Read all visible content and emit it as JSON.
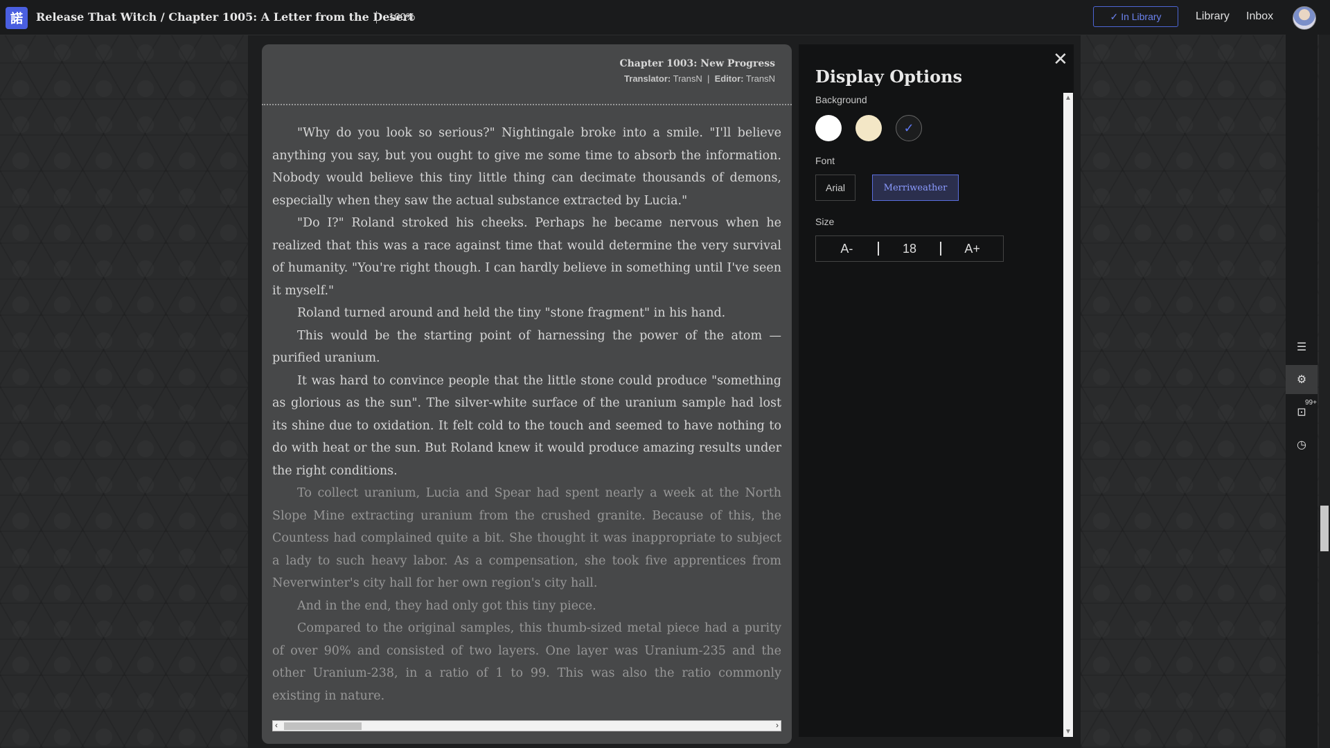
{
  "topbar": {
    "logo_glyph": "諾",
    "breadcrumb": "Release That Witch / Chapter 1005: A Letter from the Desert",
    "zoom": "100%",
    "in_library_label": "In Library",
    "library_label": "Library",
    "inbox_label": "Inbox"
  },
  "reader": {
    "chapter_title": "Chapter 1003: New Progress",
    "translator_label": "Translator:",
    "translator": "TransN",
    "editor_label": "Editor:",
    "editor": "TransN",
    "paragraphs": [
      "\"Why do you look so serious?\" Nightingale broke into a smile. \"I'll believe anything you say, but you ought to give me some time to absorb the information. Nobody would believe this tiny little thing can decimate thousands of demons, especially when they saw the actual substance extracted by Lucia.\"",
      "\"Do I?\" Roland stroked his cheeks. Perhaps he became nervous when he realized that this was a race against time that would determine the very survival of humanity. \"You're right though. I can hardly believe in something until I've seen it myself.\"",
      "Roland turned around and held the tiny \"stone fragment\" in his hand.",
      "This would be the starting point of harnessing the power of the atom — purified uranium.",
      "It was hard to convince people that the little stone could produce \"something as glorious as the sun\". The silver-white surface of the uranium sample had lost its shine due to oxidation. It felt cold to the touch and seemed to have nothing to do with heat or the sun. But Roland knew it would produce amazing results under the right conditions.",
      "To collect uranium, Lucia and Spear had spent nearly a week at the North Slope Mine extracting uranium from the crushed granite. Because of this, the Countess had complained quite a bit. She thought it was inappropriate to subject a lady to such heavy labor. As a compensation, she took five apprentices from Neverwinter's city hall for her own region's city hall.",
      "And in the end, they had only got this tiny piece.",
      "Compared to the original samples, this thumb-sized metal piece had a purity of over 90% and consisted of two layers. One layer was Uranium-235 and the other Uranium-238, in a ratio of 1 to 99. This was also the ratio commonly existing in nature."
    ]
  },
  "options": {
    "title": "Display Options",
    "background_label": "Background",
    "font_label": "Font",
    "font_arial": "Arial",
    "font_merriweather": "Merriweather",
    "size_label": "Size",
    "size_decrease": "A-",
    "size_value": "18",
    "size_increase": "A+",
    "selected_background": "dark",
    "selected_font": "Merriweather"
  },
  "rail": {
    "badge": "99+"
  },
  "colors": {
    "accent": "#5b6fe0",
    "reader_bg": "#474849",
    "panel_bg": "#121314"
  }
}
